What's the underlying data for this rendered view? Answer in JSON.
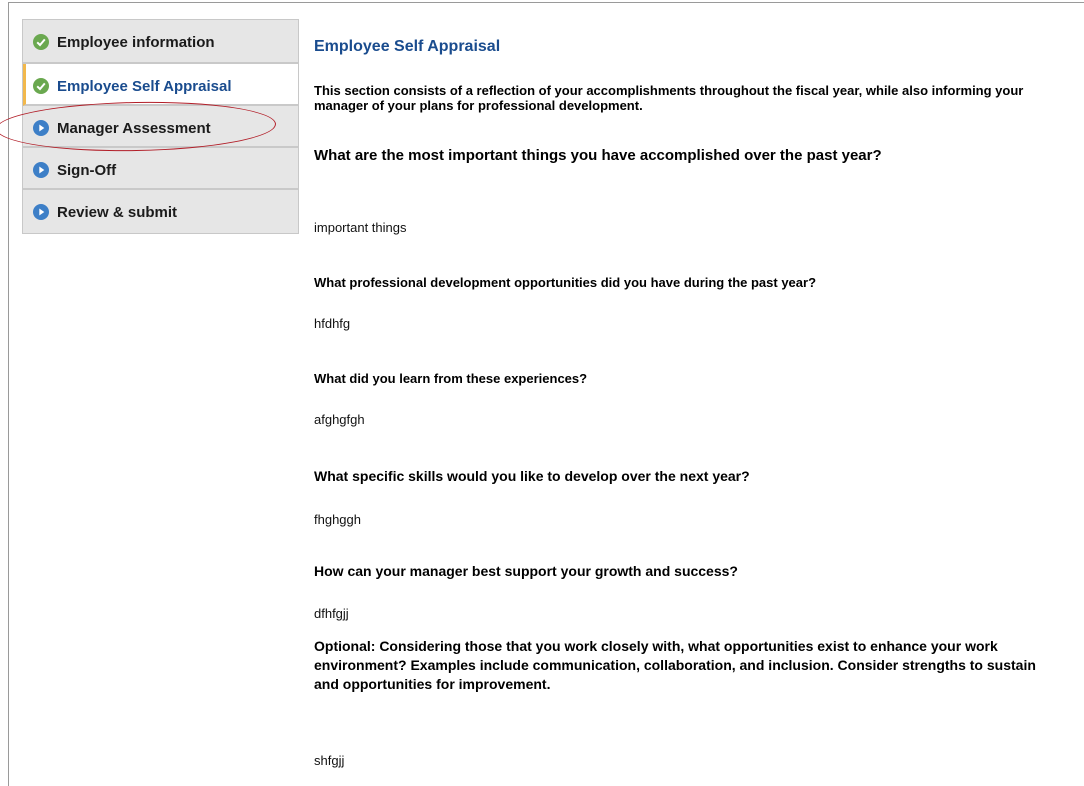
{
  "sidebar": {
    "items": [
      {
        "label": "Employee information",
        "status": "complete",
        "icon": "check-circle-icon"
      },
      {
        "label": "Employee Self Appraisal",
        "status": "complete",
        "icon": "check-circle-icon",
        "active": true
      },
      {
        "label": "Manager Assessment",
        "status": "pending",
        "icon": "play-circle-icon"
      },
      {
        "label": "Sign-Off",
        "status": "pending",
        "icon": "play-circle-icon"
      },
      {
        "label": "Review & submit",
        "status": "pending",
        "icon": "play-circle-icon"
      }
    ]
  },
  "main": {
    "title": "Employee Self Appraisal",
    "intro": "This section consists of a reflection of your accomplishments throughout the fiscal year, while also informing your manager of your plans for professional development.",
    "questions": [
      {
        "question": "What are the most important things you have accomplished over the past year?",
        "answer": "important things"
      },
      {
        "question": "What professional development opportunities did you have during the past year?",
        "answer": "hfdhfg"
      },
      {
        "question": "What did you learn from these experiences?",
        "answer": "afghgfgh"
      },
      {
        "question": "What specific skills would you like to develop over the next year?",
        "answer": "fhghggh"
      },
      {
        "question": "How can your manager best support your growth and success?",
        "answer": "dfhfgjj"
      },
      {
        "question": "Optional: Considering those that you work closely with, what opportunities exist to enhance your work environment? Examples include communication, collaboration, and inclusion. Consider strengths to sustain and opportunities for improvement.",
        "answer": "shfgjj"
      }
    ]
  },
  "colors": {
    "check": "#6aa84f",
    "play": "#3d7fc7",
    "title": "#1a4c8e",
    "annotation": "#b21e28"
  }
}
